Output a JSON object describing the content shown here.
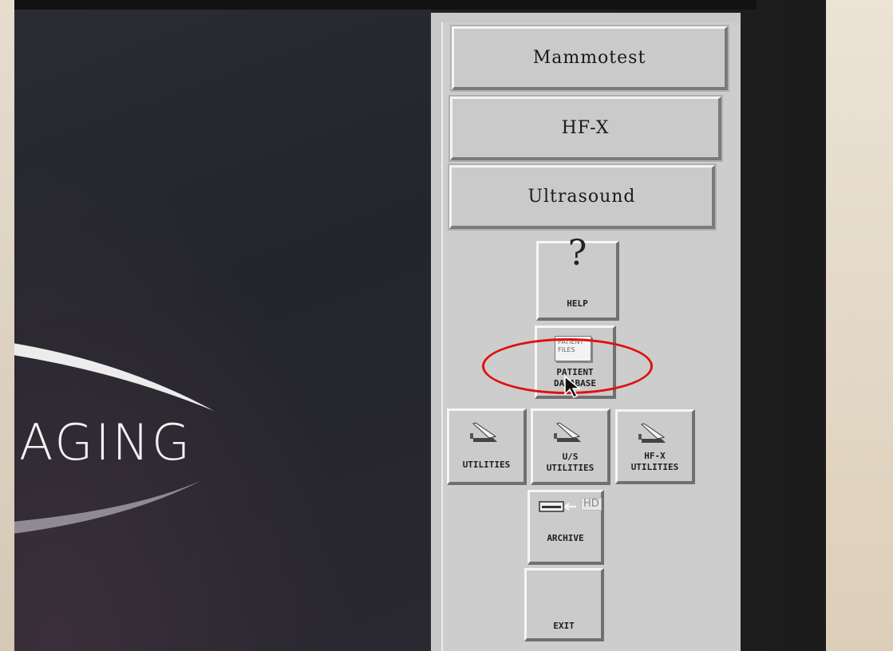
{
  "screen_logo": {
    "text": "AGING"
  },
  "top_buttons": [
    {
      "label": "Mammotest"
    },
    {
      "label": "HF-X"
    },
    {
      "label": "Ultrasound"
    }
  ],
  "help": {
    "glyph": "?",
    "label": "HELP"
  },
  "patient_database": {
    "icon_text": "PATIENT\nFILES",
    "label": "PATIENT\nDATABASE"
  },
  "utilities": [
    {
      "label": "UTILITIES",
      "icon": "pocket-knife-icon"
    },
    {
      "label": "U/S\nUTILITIES",
      "icon": "pocket-knife-icon"
    },
    {
      "label": "HF-X\nUTILITIES",
      "icon": "pocket-knife-icon"
    }
  ],
  "archive": {
    "icon_text": "HD",
    "label": "ARCHIVE"
  },
  "exit": {
    "label": "EXIT"
  },
  "colors": {
    "panel": "#cacaca",
    "annotation": "#e01010",
    "screen": "#26272e"
  }
}
